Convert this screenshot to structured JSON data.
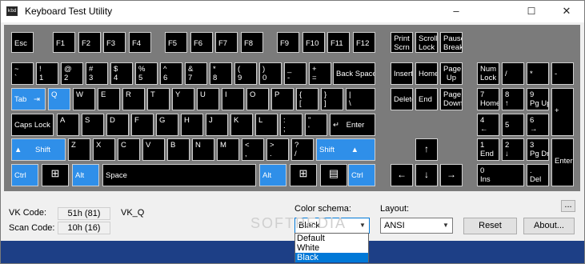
{
  "window": {
    "title": "Keyboard Test Utility",
    "icon": "app-icon",
    "minimize": "–",
    "maximize": "☐",
    "close": "✕"
  },
  "keyboard": {
    "esc": "Esc",
    "f1": "F1",
    "f2": "F2",
    "f3": "F3",
    "f4": "F4",
    "f5": "F5",
    "f6": "F6",
    "f7": "F7",
    "f8": "F8",
    "f9": "F9",
    "f10": "F10",
    "f11": "F11",
    "f12": "F12",
    "print_1": "Print",
    "print_2": "Scrn",
    "scroll_1": "Scroll",
    "scroll_2": "Lock",
    "pause_1": "Pause",
    "pause_2": "Break",
    "grave_1": "~",
    "grave_2": "`",
    "n1_1": "!",
    "n1_2": "1",
    "n2_1": "@",
    "n2_2": "2",
    "n3_1": "#",
    "n3_2": "3",
    "n4_1": "$",
    "n4_2": "4",
    "n5_1": "%",
    "n5_2": "5",
    "n6_1": "^",
    "n6_2": "6",
    "n7_1": "&",
    "n7_2": "7",
    "n8_1": "*",
    "n8_2": "8",
    "n9_1": "(",
    "n9_2": "9",
    "n0_1": ")",
    "n0_2": "0",
    "minus_1": "_",
    "minus_2": "-",
    "equal_1": "+",
    "equal_2": "=",
    "backspace": "Back Space",
    "insert": "Insert",
    "home": "Home",
    "pgup_1": "Page",
    "pgup_2": "Up",
    "numlock_1": "Num",
    "numlock_2": "Lock",
    "np_div": "/",
    "np_mul": "*",
    "np_sub": "-",
    "tab": "Tab",
    "tab_icon": "⇥",
    "q": "Q",
    "w": "W",
    "e": "E",
    "r": "R",
    "t": "T",
    "y": "Y",
    "u": "U",
    "i": "I",
    "o": "O",
    "p": "P",
    "lbr_1": "{",
    "lbr_2": "[",
    "rbr_1": "}",
    "rbr_2": "]",
    "bsl_1": "|",
    "bsl_2": "\\",
    "delete": "Delete",
    "end": "End",
    "pgdn_1": "Page",
    "pgdn_2": "Down",
    "np7_1": "7",
    "np7_2": "Home",
    "np8_1": "8",
    "np8_2": "↑",
    "np9_1": "9",
    "np9_2": "Pg Up",
    "np_add": "+",
    "caps": "Caps Lock",
    "a": "A",
    "s": "S",
    "d": "D",
    "f": "F",
    "g": "G",
    "h": "H",
    "j": "J",
    "k": "K",
    "l": "L",
    "semi_1": ":",
    "semi_2": ";",
    "quote_1": "\"",
    "quote_2": "'",
    "enter": "Enter",
    "enter_icon": "↵",
    "np4_1": "4",
    "np4_2": "←",
    "np5": "5",
    "np6_1": "6",
    "np6_2": "→",
    "lshift": "Shift",
    "shift_icon": "▲",
    "z": "Z",
    "x": "X",
    "c": "C",
    "v": "V",
    "b": "B",
    "n": "N",
    "m": "M",
    "comma_1": "<",
    "comma_2": ",",
    "period_1": ">",
    "period_2": ".",
    "slash_1": "?",
    "slash_2": "/",
    "rshift": "Shift",
    "up": "↑",
    "np1_1": "1",
    "np1_2": "End",
    "np2_1": "2",
    "np2_2": "↓",
    "np3_1": "3",
    "np3_2": "Pg Dn",
    "np_enter": "Enter",
    "lctrl": "Ctrl",
    "lwin": "⊞",
    "lalt": "Alt",
    "space": "Space",
    "ralt": "Alt",
    "rwin": "⊞",
    "menu": "▤",
    "rctrl": "Ctrl",
    "left": "←",
    "down": "↓",
    "right": "→",
    "np0_1": "0",
    "np0_2": "Ins",
    "npdot_1": ".",
    "npdot_2": "Del"
  },
  "info": {
    "vk_label": "VK Code:",
    "vk_value": "51h (81)",
    "vk_name": "VK_Q",
    "scan_label": "Scan Code:",
    "scan_value": "10h (16)"
  },
  "controls": {
    "schema_label": "Color schema:",
    "schema_value": "Black",
    "schema_options": [
      "Default",
      "White",
      "Black"
    ],
    "layout_label": "Layout:",
    "layout_value": "ANSI",
    "more_button": "...",
    "reset_button": "Reset",
    "about_button": "About..."
  },
  "watermark": "SOFTPEDIA"
}
